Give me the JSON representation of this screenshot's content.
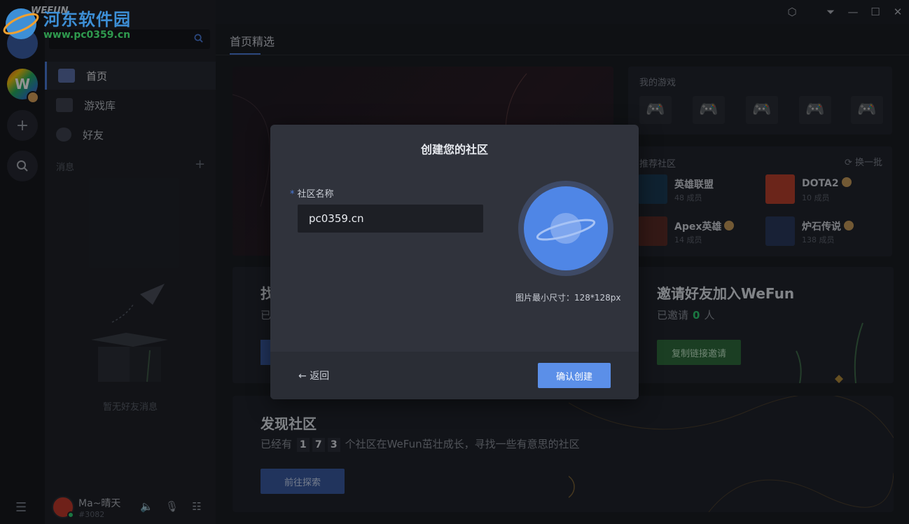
{
  "titlebar": {
    "app_name": "WEFUN"
  },
  "watermark": {
    "title": "河东软件园",
    "url": "www.pc0359.cn"
  },
  "sidebar": {
    "search_placeholder": "",
    "nav": [
      {
        "label": "首页",
        "icon": "home-icon"
      },
      {
        "label": "游戏库",
        "icon": "gamepad-icon"
      },
      {
        "label": "好友",
        "icon": "user-icon"
      }
    ],
    "messages_label": "消息",
    "empty_text": "暂无好友消息"
  },
  "user": {
    "name": "Ma~晴天",
    "id": "#3082"
  },
  "main": {
    "tab": "首页精选",
    "my_games_title": "我的游戏",
    "recommended": {
      "title": "推荐社区",
      "refresh": "换一批",
      "items": [
        {
          "name": "英雄联盟",
          "count": "48 成员"
        },
        {
          "name": "DOTA2",
          "count": "10 成员"
        },
        {
          "name": "Apex英雄",
          "count": "14 成员"
        },
        {
          "name": "炉石传说",
          "count": "138 成员"
        }
      ]
    },
    "invite": {
      "title": "邀请好友加入WeFun",
      "prefix": "已邀请",
      "count": "0",
      "suffix": "人",
      "button": "复制链接邀请"
    },
    "partial": {
      "title": "找",
      "sub": "已"
    },
    "discover": {
      "title": "发现社区",
      "prefix": "已经有",
      "digits": [
        "1",
        "7",
        "3"
      ],
      "suffix": "个社区在WeFun茁壮成长，寻找一些有意思的社区",
      "button": "前往探索"
    }
  },
  "modal": {
    "title": "创建您的社区",
    "field_required_mark": "*",
    "field_label": "社区名称",
    "field_value": "pc0359.cn",
    "size_hint": "图片最小尺寸：128*128px",
    "back": "返回",
    "confirm": "确认创建"
  },
  "colors": {
    "accent": "#4a7bd8",
    "confirm": "#5b8fe8",
    "invite_green": "#2f6b3d"
  }
}
